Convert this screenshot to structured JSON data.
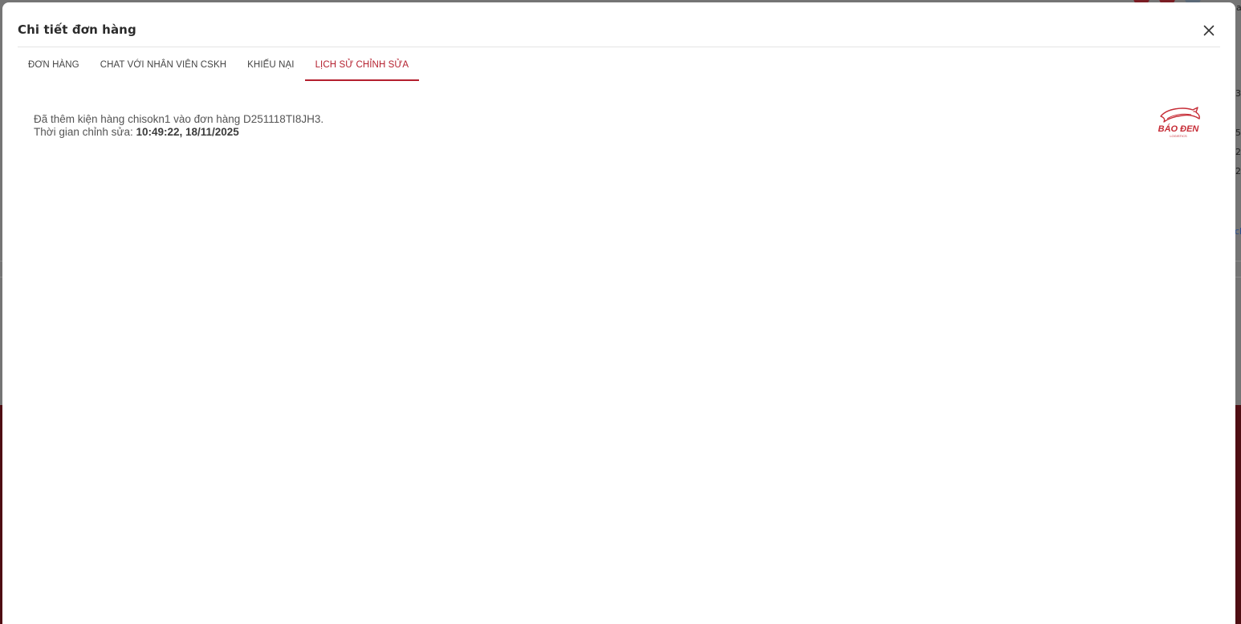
{
  "modal": {
    "title": "Chi tiết đơn hàng"
  },
  "tabs": [
    {
      "label": "ĐƠN HÀNG",
      "active": false
    },
    {
      "label": "CHAT VỚI NHÂN VIÊN CSKH",
      "active": false
    },
    {
      "label": "KHIẾU NẠI",
      "active": false
    },
    {
      "label": "LỊCH SỬ CHỈNH SỬA",
      "active": true
    }
  ],
  "history": {
    "message": "Đã thêm kiện hàng chisokn1 vào đơn hàng D251118TI8JH3.",
    "time_label": "Thời gian chỉnh sửa: ",
    "time_value": "10:49:22, 18/11/2025"
  },
  "logo": {
    "brand": "BÁO ĐEN",
    "sub": "LOGISTICS"
  },
  "background": {
    "fragments": [
      "a",
      "3",
      "5",
      "2",
      "2",
      "ch"
    ]
  },
  "colors": {
    "accent": "#b41f2d",
    "background_lower": "#4f0e13"
  },
  "icons": {
    "close": "close-icon"
  }
}
